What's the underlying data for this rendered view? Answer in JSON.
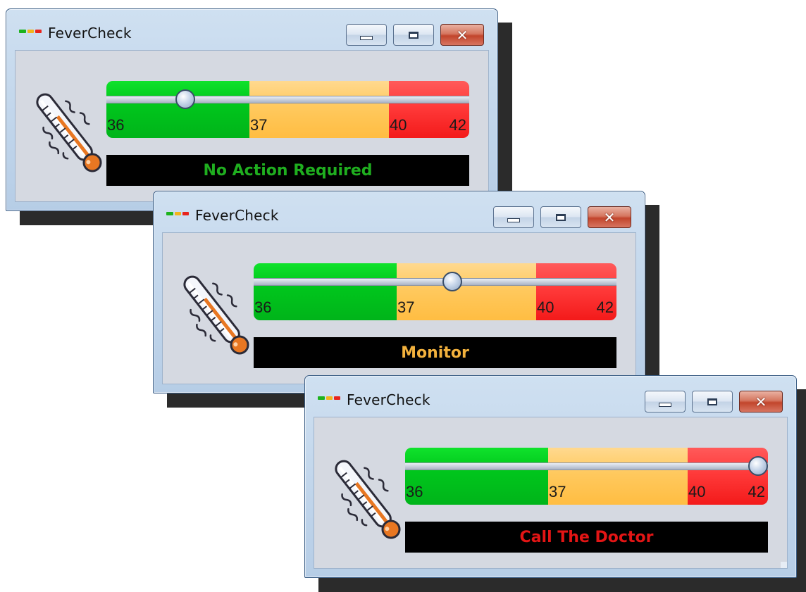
{
  "app_icon_colors": [
    "#1db31d",
    "#f3b41c",
    "#e8241c"
  ],
  "scale_colors": {
    "green": "#00c71c",
    "yellow": "#ffc95e",
    "red": "#ff3a3a"
  },
  "windows": [
    {
      "title": "FeverCheck",
      "buttons": {
        "minimize": "minimize-icon",
        "maximize": "maximize-icon",
        "close": "close-icon"
      },
      "close_glyph": "✕",
      "scale": {
        "min": 36,
        "max": 42,
        "value": 36.55,
        "ticks": [
          {
            "label": "36",
            "value": 36
          },
          {
            "label": "37",
            "value": 37
          },
          {
            "label": "40",
            "value": 40
          },
          {
            "label": "42",
            "value": 42
          }
        ]
      },
      "status": {
        "text": "No Action Required",
        "color": "#1fae1f"
      }
    },
    {
      "title": "FeverCheck",
      "buttons": {
        "minimize": "minimize-icon",
        "maximize": "maximize-icon",
        "close": "close-icon"
      },
      "close_glyph": "✕",
      "scale": {
        "min": 36,
        "max": 42,
        "value": 38.2,
        "ticks": [
          {
            "label": "36",
            "value": 36
          },
          {
            "label": "37",
            "value": 37
          },
          {
            "label": "40",
            "value": 40
          },
          {
            "label": "42",
            "value": 42
          }
        ]
      },
      "status": {
        "text": "Monitor",
        "color": "#f2b13d"
      }
    },
    {
      "title": "FeverCheck",
      "buttons": {
        "minimize": "minimize-icon",
        "maximize": "maximize-icon",
        "close": "close-icon"
      },
      "close_glyph": "✕",
      "scale": {
        "min": 36,
        "max": 42,
        "value": 41.8,
        "ticks": [
          {
            "label": "36",
            "value": 36
          },
          {
            "label": "37",
            "value": 37
          },
          {
            "label": "40",
            "value": 40
          },
          {
            "label": "42",
            "value": 42
          }
        ]
      },
      "status": {
        "text": "Call The Doctor",
        "color": "#e31515"
      }
    }
  ]
}
